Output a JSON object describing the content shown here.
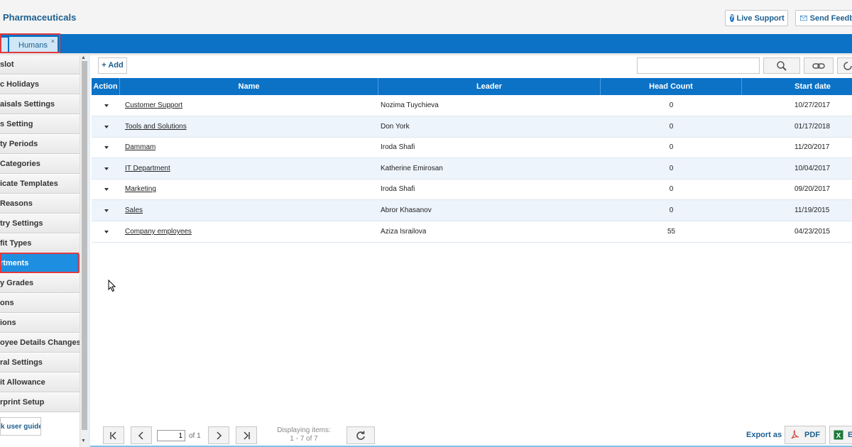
{
  "header": {
    "app_title": "Pharmaceuticals",
    "live_support": "Live Support",
    "send_feedback": "Send Feedb"
  },
  "tabs": [
    {
      "label": "Humans",
      "close": "×"
    }
  ],
  "sidebar": {
    "items": [
      {
        "label": "slot"
      },
      {
        "label": "c Holidays"
      },
      {
        "label": "aisals Settings"
      },
      {
        "label": "s Setting"
      },
      {
        "label": "ty Periods"
      },
      {
        "label": "Categories"
      },
      {
        "label": "icate Templates"
      },
      {
        "label": "Reasons"
      },
      {
        "label": "try Settings"
      },
      {
        "label": "fit Types"
      },
      {
        "label": "rtments"
      },
      {
        "label": "y Grades"
      },
      {
        "label": "ons"
      },
      {
        "label": "ions"
      },
      {
        "label": "oyee Details Changes"
      },
      {
        "label": "ral Settings"
      },
      {
        "label": "it Allowance"
      },
      {
        "label": "rprint Setup"
      }
    ],
    "active_index": 10,
    "guide_button": "k user guide"
  },
  "toolbar": {
    "add_label": "+ Add",
    "search_value": ""
  },
  "grid": {
    "columns": [
      "Action",
      "Name",
      "Leader",
      "Head Count",
      "Start date"
    ],
    "rows": [
      {
        "name": "Customer Support",
        "leader": "Nozima Tuychieva",
        "head_count": "0",
        "start_date": "10/27/2017"
      },
      {
        "name": "Tools and Solutions",
        "leader": "Don York",
        "head_count": "0",
        "start_date": "01/17/2018"
      },
      {
        "name": "Dammam",
        "leader": "Iroda Shafi",
        "head_count": "0",
        "start_date": "11/20/2017"
      },
      {
        "name": "IT Department",
        "leader": "Katherine Emirosan",
        "head_count": "0",
        "start_date": "10/04/2017"
      },
      {
        "name": "Marketing",
        "leader": "Iroda Shafi",
        "head_count": "0",
        "start_date": "09/20/2017"
      },
      {
        "name": "Sales",
        "leader": "Abror Khasanov",
        "head_count": "0",
        "start_date": "11/19/2015"
      },
      {
        "name": "Company employees",
        "leader": "Aziza Israilova",
        "head_count": "55",
        "start_date": "04/23/2015"
      }
    ]
  },
  "pager": {
    "page": "1",
    "of_text": "of 1",
    "displaying_label": "Displaying items:",
    "displaying_range": "1 - 7 of 7"
  },
  "export": {
    "label": "Export as",
    "pdf": "PDF",
    "excel": "E"
  },
  "colors": {
    "brand_blue": "#0b72c6",
    "active_item": "#1e8fe0",
    "highlight_outline": "#e0393e",
    "alt_row": "#edf4fc"
  }
}
